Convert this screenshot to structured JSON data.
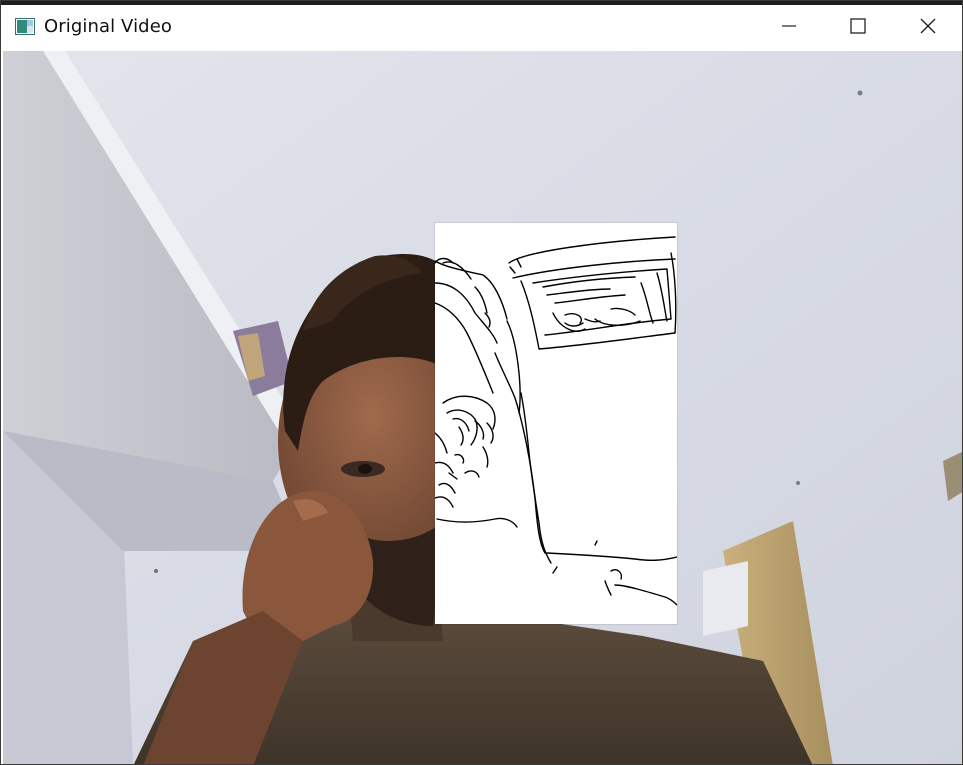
{
  "window": {
    "title": "Original Video"
  },
  "icons": {
    "app": "app-window-icon",
    "minimize": "minimize-icon",
    "maximize": "maximize-icon",
    "close": "close-icon"
  }
}
